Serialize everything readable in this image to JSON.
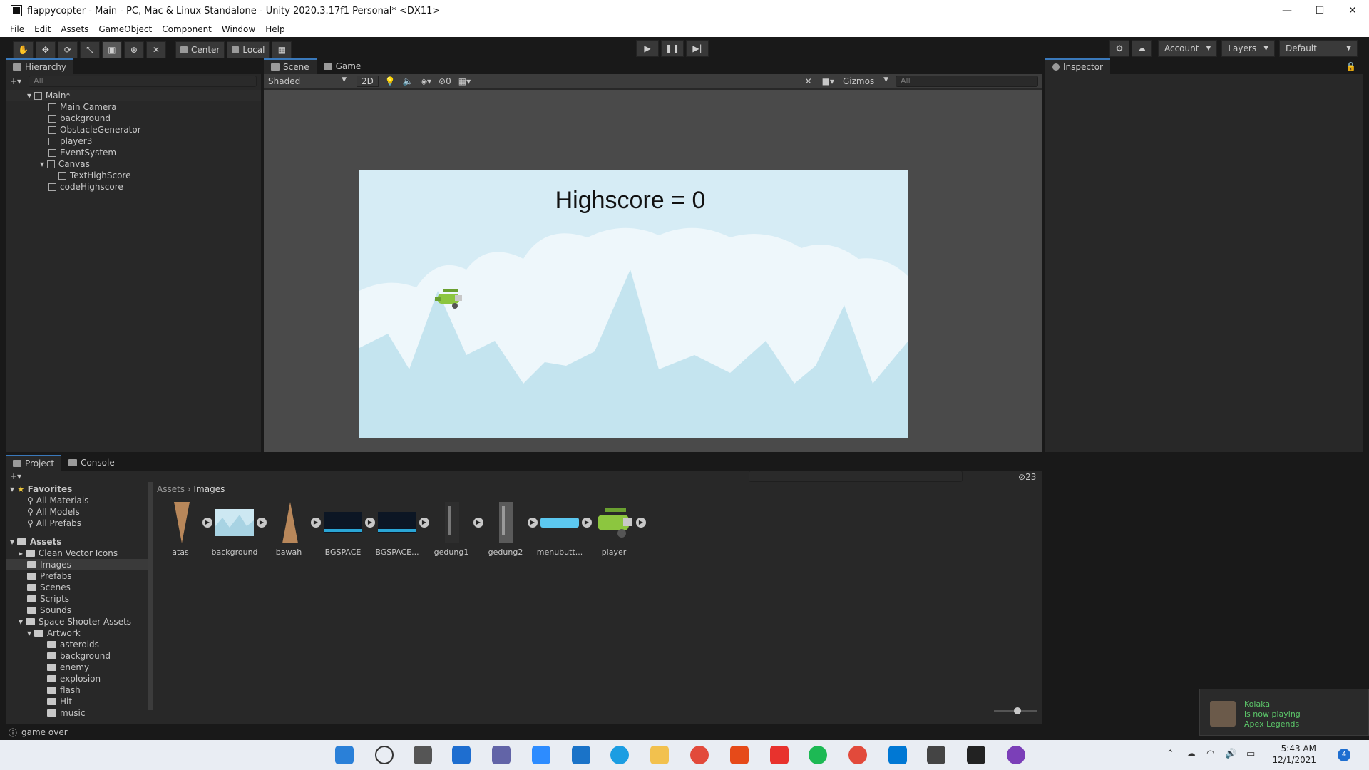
{
  "window": {
    "title": "flappycopter - Main - PC, Mac & Linux Standalone - Unity 2020.3.17f1 Personal* <DX11>",
    "min": "—",
    "max": "☐",
    "close": "✕"
  },
  "menu": [
    "File",
    "Edit",
    "Assets",
    "GameObject",
    "Component",
    "Window",
    "Help"
  ],
  "toolbar": {
    "center_label": "Center",
    "local_label": "Local",
    "account": "Account",
    "layers": "Layers",
    "layout": "Default"
  },
  "hierarchy": {
    "tab": "Hierarchy",
    "search_placeholder": "All",
    "scene": "Main*",
    "items": [
      "Main Camera",
      "background",
      "ObstacleGenerator",
      "player3",
      "EventSystem",
      "Canvas",
      "TextHighScore",
      "codeHighscore"
    ]
  },
  "scene": {
    "tab_scene": "Scene",
    "tab_game": "Game",
    "shading": "Shaded",
    "mode_2d": "2D",
    "hidden_count": "0",
    "gizmos": "Gizmos",
    "search_placeholder": "All",
    "highscore_text": "Highscore = 0"
  },
  "inspector": {
    "tab": "Inspector"
  },
  "project": {
    "tab_project": "Project",
    "tab_console": "Console",
    "count": "23",
    "breadcrumb": [
      "Assets",
      "Images"
    ],
    "favorites_label": "Favorites",
    "favorites": [
      "All Materials",
      "All Models",
      "All Prefabs"
    ],
    "assets_label": "Assets",
    "folders": [
      "Clean Vector Icons",
      "Images",
      "Prefabs",
      "Scenes",
      "Scripts",
      "Sounds",
      "Space Shooter Assets",
      "Artwork",
      "asteroids",
      "background",
      "enemy",
      "explosion",
      "flash",
      "Hit",
      "music"
    ],
    "files": [
      "atas",
      "background",
      "bawah",
      "BGSPACE",
      "BGSPACE...",
      "gedung1",
      "gedung2",
      "menubutt...",
      "player"
    ]
  },
  "status": {
    "message": "game over"
  },
  "notification": {
    "name": "Kolaka",
    "line1": "is now playing",
    "line2": "Apex Legends"
  },
  "clock": {
    "time": "5:43 AM",
    "date": "12/1/2021",
    "badge": "4"
  }
}
